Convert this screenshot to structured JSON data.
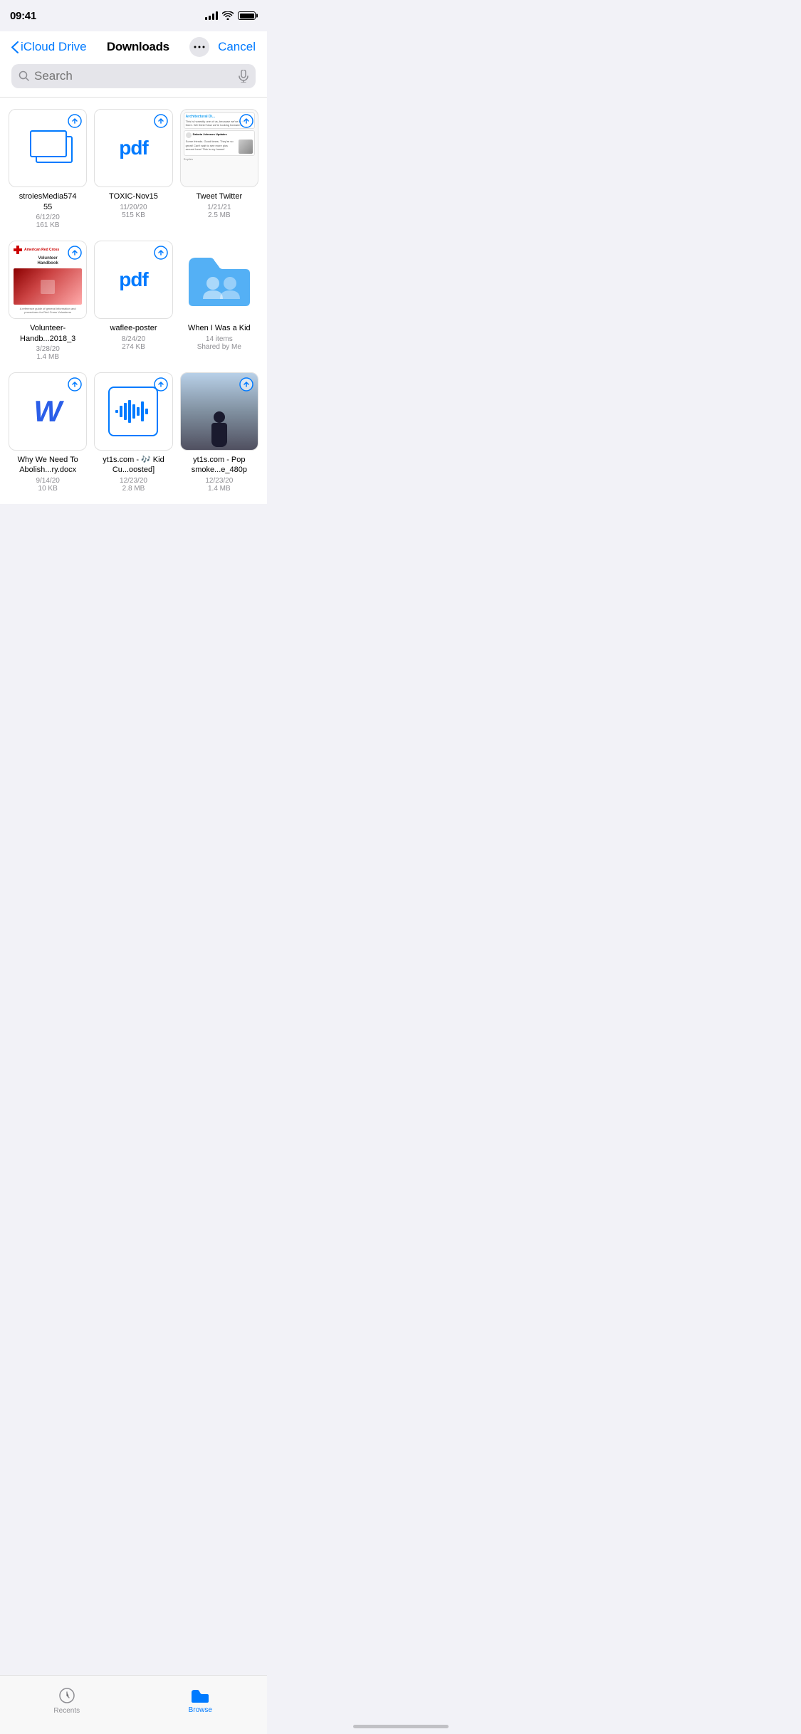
{
  "status_bar": {
    "time": "09:41",
    "signal_strength": 4,
    "wifi": true,
    "battery_full": true
  },
  "nav": {
    "back_label": "iCloud Drive",
    "title": "Downloads",
    "more_label": "•••",
    "cancel_label": "Cancel"
  },
  "search": {
    "placeholder": "Search"
  },
  "files": [
    {
      "id": "stroies",
      "name": "stroiesMedia574\n55",
      "date": "6/12/20",
      "size": "161 KB",
      "type": "slides",
      "has_upload": true
    },
    {
      "id": "toxic",
      "name": "TOXIC-Nov15",
      "date": "11/20/20",
      "size": "515 KB",
      "type": "pdf",
      "has_upload": true
    },
    {
      "id": "tweet",
      "name": "Tweet  Twitter",
      "date": "1/21/21",
      "size": "2.5 MB",
      "type": "screenshot",
      "has_upload": true
    },
    {
      "id": "volunteer",
      "name": "Volunteer-Handb...2018_3",
      "date": "3/28/20",
      "size": "1.4 MB",
      "type": "handbook",
      "has_upload": true
    },
    {
      "id": "waflee",
      "name": "waflee-poster",
      "date": "8/24/20",
      "size": "274 KB",
      "type": "pdf",
      "has_upload": true
    },
    {
      "id": "when-i-was-a-kid",
      "name": "When I Was a Kid",
      "date": "",
      "size": "14 items",
      "extra": "Shared by Me",
      "type": "folder",
      "has_upload": false
    },
    {
      "id": "why-we-need",
      "name": "Why We Need To Abolish...ry.docx",
      "date": "9/14/20",
      "size": "10 KB",
      "type": "word",
      "has_upload": true
    },
    {
      "id": "yt1s-kid",
      "name": "yt1s.com - 🎶 Kid Cu...oosted]",
      "date": "12/23/20",
      "size": "2.8 MB",
      "type": "audio",
      "has_upload": true
    },
    {
      "id": "yt1s-pop",
      "name": "yt1s.com - Pop smoke...e_480p",
      "date": "12/23/20",
      "size": "1.4 MB",
      "type": "video",
      "has_upload": true
    }
  ],
  "tabs": [
    {
      "id": "recents",
      "label": "Recents",
      "active": false
    },
    {
      "id": "browse",
      "label": "Browse",
      "active": true
    }
  ],
  "icons": {
    "back_chevron": "‹",
    "more_dots": "•••",
    "search": "🔍",
    "microphone": "🎙",
    "upload_cloud": "↑",
    "recents_clock": "🕐",
    "browse_folder": "📁"
  }
}
